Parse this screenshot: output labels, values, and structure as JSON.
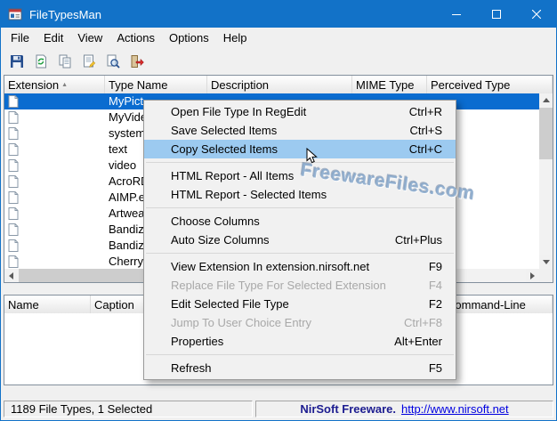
{
  "window": {
    "title": "FileTypesMan",
    "controls": [
      "minimize",
      "maximize",
      "close"
    ]
  },
  "menubar": {
    "items": [
      "File",
      "Edit",
      "View",
      "Actions",
      "Options",
      "Help"
    ]
  },
  "toolbar": {
    "buttons": [
      "save",
      "refresh",
      "copy",
      "properties",
      "find",
      "exit"
    ]
  },
  "list": {
    "columns": [
      "Extension",
      "Type Name",
      "Description",
      "MIME Type",
      "Perceived Type"
    ],
    "sort": {
      "column": "Extension",
      "direction": "asc"
    },
    "rows": [
      {
        "type_name": "MyPict",
        "selected": true
      },
      {
        "type_name": "MyVide"
      },
      {
        "type_name": "system"
      },
      {
        "type_name": "text"
      },
      {
        "type_name": "video"
      },
      {
        "type_name": "AcroRD"
      },
      {
        "type_name": "AIMP.e"
      },
      {
        "type_name": "Artwea"
      },
      {
        "type_name": "Bandizi"
      },
      {
        "type_name": "Bandizi"
      },
      {
        "type_name": "CherryP"
      }
    ]
  },
  "context_menu": {
    "items": [
      {
        "label": "Open File Type In RegEdit",
        "shortcut": "Ctrl+R"
      },
      {
        "label": "Save Selected Items",
        "shortcut": "Ctrl+S"
      },
      {
        "label": "Copy Selected Items",
        "shortcut": "Ctrl+C",
        "highlighted": true
      },
      {
        "separator": true
      },
      {
        "label": "HTML Report - All Items"
      },
      {
        "label": "HTML Report - Selected Items"
      },
      {
        "separator": true
      },
      {
        "label": "Choose Columns"
      },
      {
        "label": "Auto Size Columns",
        "shortcut": "Ctrl+Plus"
      },
      {
        "separator": true
      },
      {
        "label": "View Extension In extension.nirsoft.net",
        "shortcut": "F9"
      },
      {
        "label": "Replace File Type For Selected Extension",
        "shortcut": "F4",
        "disabled": true
      },
      {
        "label": "Edit Selected File Type",
        "shortcut": "F2"
      },
      {
        "label": "Jump To User Choice Entry",
        "shortcut": "Ctrl+F8",
        "disabled": true
      },
      {
        "label": "Properties",
        "shortcut": "Alt+Enter"
      },
      {
        "separator": true
      },
      {
        "label": "Refresh",
        "shortcut": "F5"
      }
    ]
  },
  "bottom_pane": {
    "columns": [
      "Name",
      "Caption",
      "Command-Line"
    ]
  },
  "status_bar": {
    "left": "1189 File Types, 1 Selected",
    "brand": "NirSoft Freeware.",
    "link": "http://www.nirsoft.net"
  },
  "watermark": {
    "text": "FreewareFiles.com"
  }
}
